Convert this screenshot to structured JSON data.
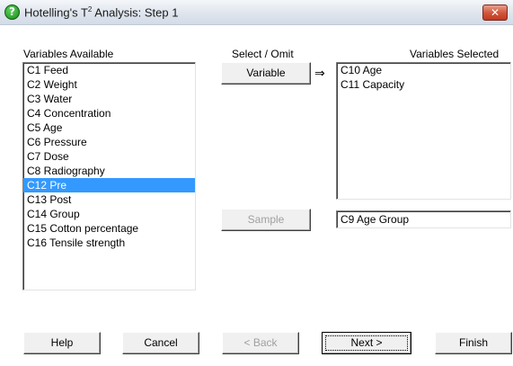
{
  "window": {
    "title_prefix": "Hotelling's T",
    "title_sup": "2",
    "title_suffix": " Analysis: Step 1",
    "close_label": "✕"
  },
  "labels": {
    "available": "Variables Available",
    "select_omit": "Select / Omit",
    "selected": "Variables Selected"
  },
  "available": {
    "items": [
      "C1 Feed",
      "C2 Weight",
      "C3 Water",
      "C4 Concentration",
      "C5 Age",
      "C6 Pressure",
      "C7 Dose",
      "C8 Radiography",
      "C12 Pre",
      "C13 Post",
      "C14 Group",
      "C15 Cotton percentage",
      "C16 Tensile strength"
    ],
    "selected_item": "C12 Pre"
  },
  "selected_vars": {
    "items": [
      "C10 Age",
      "C11 Capacity"
    ]
  },
  "buttons": {
    "variable": "Variable",
    "sample": "Sample",
    "help": "Help",
    "cancel": "Cancel",
    "back": "< Back",
    "next": "Next >",
    "finish": "Finish"
  },
  "sample_field": {
    "value": "C9 Age Group"
  },
  "arrow": "⇒",
  "colors": {
    "selection": "#3399ff",
    "close_button": "#c0391e"
  }
}
